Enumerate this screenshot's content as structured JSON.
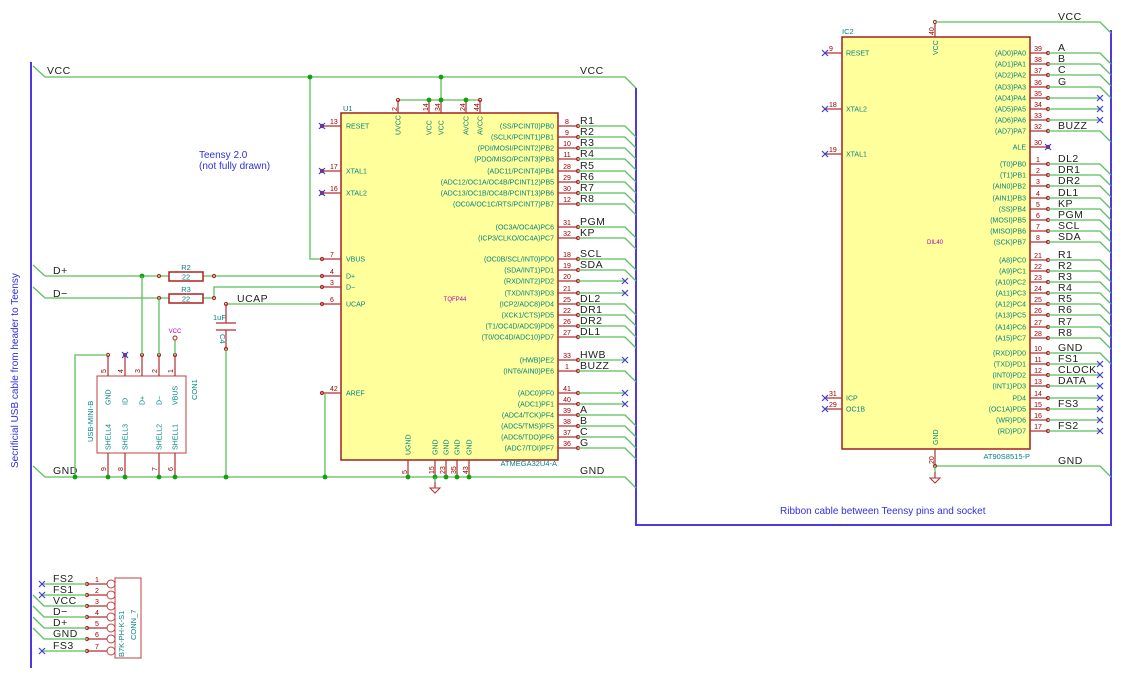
{
  "notes": {
    "teensy_line1": "Teensy 2.0",
    "teensy_line2": "(not fully drawn)",
    "usb_cable": "Secrificial USB cable from header to Teensy",
    "ribbon": "Ribbon cable between Teensy pins and socket"
  },
  "nets": {
    "vcc": "VCC",
    "gnd": "GND",
    "dplus": "D+",
    "dminus": "D−",
    "ucap": "UCAP"
  },
  "u1": {
    "ref": "U1",
    "value": "ATMEGA32U4-A",
    "footprint": "TQFP44",
    "left_pins": [
      {
        "num": "13",
        "name": "RESET"
      },
      {
        "num": "17",
        "name": "XTAL1"
      },
      {
        "num": "16",
        "name": "XTAL2"
      },
      {
        "num": "7",
        "name": "VBUS"
      },
      {
        "num": "4",
        "name": "D+"
      },
      {
        "num": "3",
        "name": "D−"
      },
      {
        "num": "6",
        "name": "UCAP"
      },
      {
        "num": "42",
        "name": "AREF"
      }
    ],
    "top_pins": [
      {
        "num": "2",
        "name": "UVCC"
      },
      {
        "num": "14",
        "name": "VCC"
      },
      {
        "num": "34",
        "name": "VCC"
      },
      {
        "num": "24",
        "name": "AVCC"
      },
      {
        "num": "44",
        "name": "AVCC"
      }
    ],
    "bottom_pins": [
      {
        "num": "5",
        "name": "UGND"
      },
      {
        "num": "15",
        "name": "GND"
      },
      {
        "num": "23",
        "name": "GND"
      },
      {
        "num": "35",
        "name": "GND"
      },
      {
        "num": "43",
        "name": "GND"
      }
    ],
    "right_pins": [
      {
        "num": "8",
        "name": "(SS/PCINT0)PB0",
        "net": "R1"
      },
      {
        "num": "9",
        "name": "(SCLK/PCINT1)PB1",
        "net": "R2"
      },
      {
        "num": "10",
        "name": "(PDI/MOSI/PCINT2)PB2",
        "net": "R3"
      },
      {
        "num": "11",
        "name": "(PDO/MISO/PCINT3)PB3",
        "net": "R4"
      },
      {
        "num": "28",
        "name": "(ADC11/PCINT4)PB4",
        "net": "R5"
      },
      {
        "num": "29",
        "name": "(ADC12/OC1A/OC4B/PCINT12)PB5",
        "net": "R6"
      },
      {
        "num": "30",
        "name": "(ADC13/OC1B/OC4B/PCINT13)PB6",
        "net": "R7"
      },
      {
        "num": "12",
        "name": "(OC0A/OC1C/RTS/PCINT7)PB7",
        "net": "R8"
      },
      {
        "num": "31",
        "name": "(OC3A/OC4A)PC6",
        "net": "PGM"
      },
      {
        "num": "32",
        "name": "(ICP3/CLKO/OC4A)PC7",
        "net": "KP"
      },
      {
        "num": "18",
        "name": "(OC0B/SCL/INT0)PD0",
        "net": "SCL"
      },
      {
        "num": "19",
        "name": "(SDA/INT1)PD1",
        "net": "SDA"
      },
      {
        "num": "20",
        "name": "(RXD/INT2)PD2",
        "net": ""
      },
      {
        "num": "21",
        "name": "(TXD/INT3)PD3",
        "net": ""
      },
      {
        "num": "25",
        "name": "(ICP2/ADC8)PD4",
        "net": "DL2"
      },
      {
        "num": "22",
        "name": "(XCK1/CTS)PD5",
        "net": "DR1"
      },
      {
        "num": "26",
        "name": "(T1/OC4D/ADC9)PD6",
        "net": "DR2"
      },
      {
        "num": "27",
        "name": "(T0/OC4D/ADC10)PD7",
        "net": "DL1"
      },
      {
        "num": "33",
        "name": "(HWB)PE2",
        "net": "HWB"
      },
      {
        "num": "1",
        "name": "(INT6/AIN0)PE6",
        "net": "BUZZ"
      },
      {
        "num": "41",
        "name": "(ADC0)PF0",
        "net": ""
      },
      {
        "num": "40",
        "name": "(ADC1)PF1",
        "net": ""
      },
      {
        "num": "39",
        "name": "(ADC4/TCK)PF4",
        "net": "A"
      },
      {
        "num": "38",
        "name": "(ADC5/TMS)PF5",
        "net": "B"
      },
      {
        "num": "37",
        "name": "(ADC6/TDO)PF6",
        "net": "C"
      },
      {
        "num": "36",
        "name": "(ADC7/TDI)PF7",
        "net": "G"
      }
    ]
  },
  "ic2": {
    "ref": "IC2",
    "value": "AT90S8515-P",
    "footprint": "DIL40",
    "top_pin": {
      "num": "40",
      "name": "VCC"
    },
    "bottom_pin": {
      "num": "20",
      "name": "GND"
    },
    "left_pins": [
      {
        "num": "9",
        "name": "RESET"
      },
      {
        "num": "18",
        "name": "XTAL2"
      },
      {
        "num": "19",
        "name": "XTAL1"
      },
      {
        "num": "31",
        "name": "ICP"
      },
      {
        "num": "29",
        "name": "OC1B"
      }
    ],
    "right_pins": [
      {
        "num": "39",
        "name": "(AD0)PA0",
        "net": "A"
      },
      {
        "num": "38",
        "name": "(AD1)PA1",
        "net": "B"
      },
      {
        "num": "37",
        "name": "(AD2)PA2",
        "net": "C"
      },
      {
        "num": "36",
        "name": "(AD3)PA3",
        "net": "G"
      },
      {
        "num": "35",
        "name": "(AD4)PA4",
        "net": ""
      },
      {
        "num": "34",
        "name": "(AD5)PA5",
        "net": ""
      },
      {
        "num": "33",
        "name": "(AD6)PA6",
        "net": ""
      },
      {
        "num": "32",
        "name": "(AD7)PA7",
        "net": "BUZZ"
      },
      {
        "num": "30",
        "name": "ALE",
        "net": ""
      },
      {
        "num": "1",
        "name": "(T0)PB0",
        "net": "DL2"
      },
      {
        "num": "2",
        "name": "(T1)PB1",
        "net": "DR1"
      },
      {
        "num": "3",
        "name": "(AIN0)PB2",
        "net": "DR2"
      },
      {
        "num": "4",
        "name": "(AIN1)PB3",
        "net": "DL1"
      },
      {
        "num": "5",
        "name": "(SS)PB4",
        "net": "KP"
      },
      {
        "num": "6",
        "name": "(MOSI)PB5",
        "net": "PGM"
      },
      {
        "num": "7",
        "name": "(MISO)PB6",
        "net": "SCL"
      },
      {
        "num": "8",
        "name": "(SCK)PB7",
        "net": "SDA"
      },
      {
        "num": "21",
        "name": "(A8)PC0",
        "net": "R1"
      },
      {
        "num": "22",
        "name": "(A9)PC1",
        "net": "R2"
      },
      {
        "num": "23",
        "name": "(A10)PC2",
        "net": "R3"
      },
      {
        "num": "24",
        "name": "(A11)PC3",
        "net": "R4"
      },
      {
        "num": "25",
        "name": "(A12)PC4",
        "net": "R5"
      },
      {
        "num": "26",
        "name": "(A13)PC5",
        "net": "R6"
      },
      {
        "num": "27",
        "name": "(A14)PC6",
        "net": "R7"
      },
      {
        "num": "28",
        "name": "(A15)PC7",
        "net": "R8"
      },
      {
        "num": "10",
        "name": "(RXD)PD0",
        "net": "GND"
      },
      {
        "num": "11",
        "name": "(TXD)PD1",
        "net": "FS1"
      },
      {
        "num": "12",
        "name": "(INT0)PD2",
        "net": "CLOCK"
      },
      {
        "num": "13",
        "name": "(INT1)PD3",
        "net": "DATA"
      },
      {
        "num": "14",
        "name": "PD4",
        "net": ""
      },
      {
        "num": "15",
        "name": "(OC1A)PD5",
        "net": "FS3"
      },
      {
        "num": "16",
        "name": "(WR)PD6",
        "net": ""
      },
      {
        "num": "17",
        "name": "(RD)PD7",
        "net": "FS2"
      }
    ]
  },
  "r2": {
    "ref": "R2",
    "value": "22"
  },
  "r3": {
    "ref": "R3",
    "value": "22"
  },
  "c4": {
    "ref": "C4",
    "value": "1uF"
  },
  "con1": {
    "ref": "CON1",
    "value": "USB-MINI-B",
    "vbus_power": "VCC",
    "top_pins": [
      {
        "num": "5",
        "name": "GND"
      },
      {
        "num": "4",
        "name": "ID"
      },
      {
        "num": "3",
        "name": "D+"
      },
      {
        "num": "2",
        "name": "D−"
      },
      {
        "num": "1",
        "name": "VBUS"
      }
    ],
    "bottom_pins": [
      {
        "num": "9",
        "name": "SHELL4"
      },
      {
        "num": "8",
        "name": "SHELL3"
      },
      {
        "num": "7",
        "name": "SHELL2"
      },
      {
        "num": "6",
        "name": "SHELL1"
      }
    ]
  },
  "conn7": {
    "ref": "CONN_7",
    "value": "B7K-PH-K-S1",
    "pins": [
      {
        "num": "1",
        "net": "FS2"
      },
      {
        "num": "2",
        "net": "FS1"
      },
      {
        "num": "3",
        "net": "VCC"
      },
      {
        "num": "4",
        "net": "D−"
      },
      {
        "num": "5",
        "net": "D+"
      },
      {
        "num": "6",
        "net": "GND"
      },
      {
        "num": "7",
        "net": "FS3"
      }
    ]
  },
  "colors": {
    "wire": "#5cbf5c",
    "bus": "#4a3ae0",
    "pin": "#b03030",
    "body": "#ffff9c",
    "pin_text": "#008484"
  }
}
